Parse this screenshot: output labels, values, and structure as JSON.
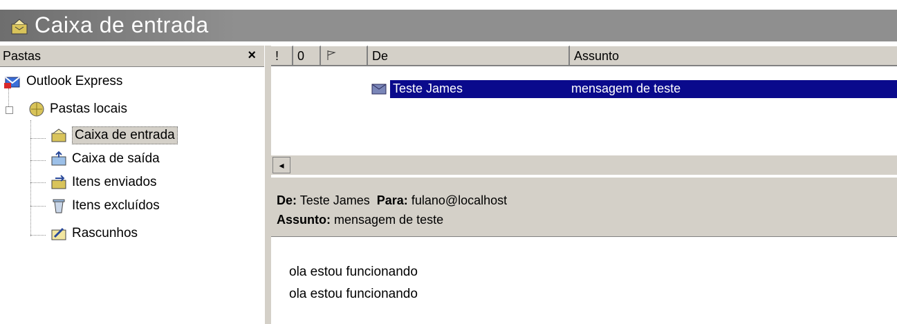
{
  "window": {
    "title": "Caixa de entrada",
    "title_icon": "inbox-icon"
  },
  "folders_pane": {
    "header": "Pastas",
    "close_label": "×",
    "items": [
      {
        "label": "Outlook Express",
        "icon": "outlook-express-icon"
      },
      {
        "label": "Pastas locais",
        "icon": "local-folders-icon"
      },
      {
        "label": "Caixa de entrada",
        "icon": "inbox-icon",
        "selected": true
      },
      {
        "label": "Caixa de saída",
        "icon": "outbox-icon"
      },
      {
        "label": "Itens enviados",
        "icon": "sent-items-icon"
      },
      {
        "label": "Itens excluídos",
        "icon": "deleted-items-icon"
      },
      {
        "label": "Rascunhos",
        "icon": "drafts-icon"
      }
    ]
  },
  "message_list": {
    "columns": {
      "priority": "!",
      "attachment": "0",
      "flag": "",
      "from": "De",
      "subject": "Assunto"
    },
    "rows": [
      {
        "from": "Teste James",
        "subject": "mensagem de teste",
        "selected": true
      }
    ],
    "scroll_left": "◂"
  },
  "preview": {
    "from_label": "De:",
    "from": "Teste James",
    "to_label": "Para:",
    "to": "fulano@localhost",
    "subject_label": "Assunto:",
    "subject": "mensagem de teste",
    "body_lines": [
      "ola estou funcionando",
      "ola estou funcionando"
    ]
  }
}
